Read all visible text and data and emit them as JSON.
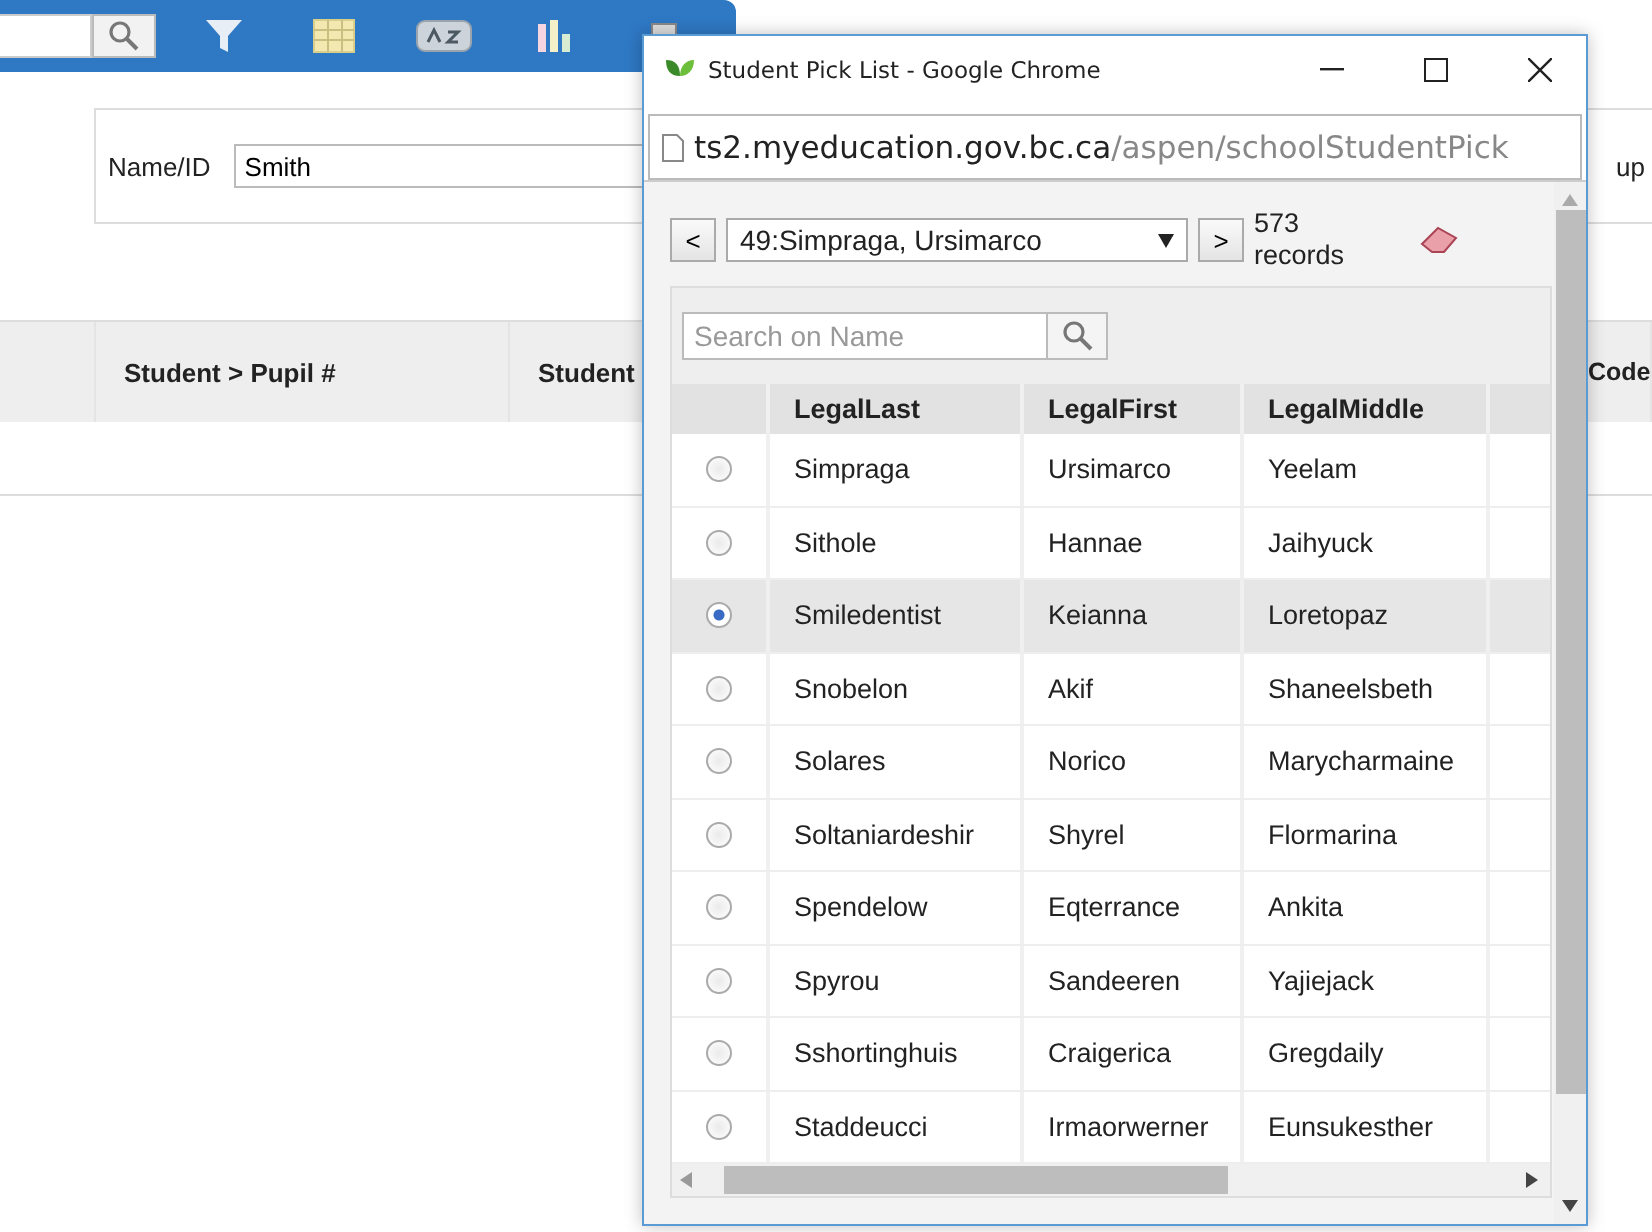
{
  "filter_panel": {
    "label": "Name/ID",
    "value": "Smith",
    "side_text": "up"
  },
  "table": {
    "columns": [
      "Student > Pupil #",
      "Student",
      "Code"
    ]
  },
  "popup": {
    "title": "Student Pick List - Google Chrome",
    "url_host": "ts2.myeducation.gov.bc.ca",
    "url_path": "/aspen/schoolStudentPick",
    "nav": {
      "prev": "<",
      "selected_record": "49:Simpraga, Ursimarco",
      "next": ">",
      "count": "573 records"
    },
    "search": {
      "placeholder": "Search on Name"
    },
    "columns": [
      "LegalLast",
      "LegalFirst",
      "LegalMiddle"
    ],
    "rows": [
      {
        "last": "Simpraga",
        "first": "Ursimarco",
        "middle": "Yeelam",
        "selected": false
      },
      {
        "last": "Sithole",
        "first": "Hannae",
        "middle": "Jaihyuck",
        "selected": false
      },
      {
        "last": "Smiledentist",
        "first": "Keianna",
        "middle": "Loretopaz",
        "selected": true
      },
      {
        "last": "Snobelon",
        "first": "Akif",
        "middle": "Shaneelsbeth",
        "selected": false
      },
      {
        "last": "Solares",
        "first": "Norico",
        "middle": "Marycharmaine",
        "selected": false
      },
      {
        "last": "Soltaniardeshir",
        "first": "Shyrel",
        "middle": "Flormarina",
        "selected": false
      },
      {
        "last": "Spendelow",
        "first": "Eqterrance",
        "middle": "Ankita",
        "selected": false
      },
      {
        "last": "Spyrou",
        "first": "Sandeeren",
        "middle": "Yajiejack",
        "selected": false
      },
      {
        "last": "Sshortinghuis",
        "first": "Craigerica",
        "middle": "Gregdaily",
        "selected": false
      },
      {
        "last": "Staddeucci",
        "first": "Irmaorwerner",
        "middle": "Eunsukesther",
        "selected": false
      }
    ]
  }
}
